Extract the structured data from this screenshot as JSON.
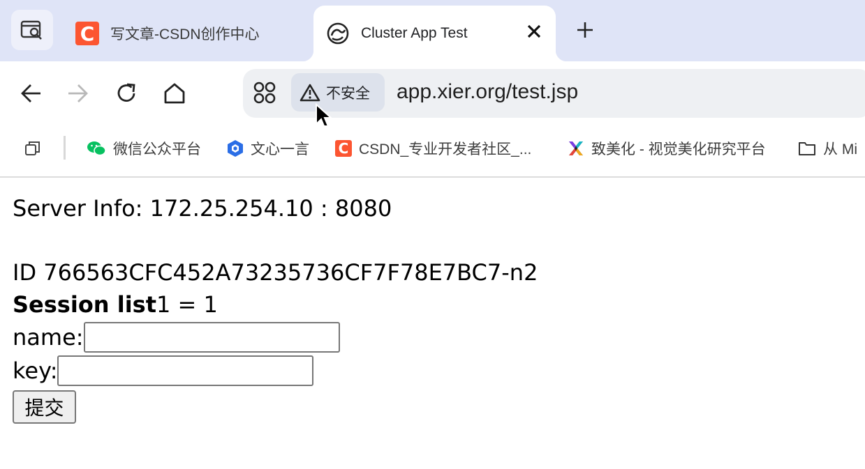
{
  "browser": {
    "tabs": [
      {
        "title": "写文章-CSDN创作中心",
        "icon": "csdn-logo-icon",
        "active": false
      },
      {
        "title": "Cluster App Test",
        "icon": "globe-swirl-icon",
        "active": true
      }
    ],
    "csdn_letter": "C",
    "address_bar": {
      "security_label": "不安全",
      "url": "app.xier.org/test.jsp"
    },
    "bookmarks": [
      {
        "label": "微信公众平台",
        "icon": "wechat-icon"
      },
      {
        "label": "文心一言",
        "icon": "wenxin-icon"
      },
      {
        "label": "CSDN_专业开发者社区_...",
        "icon": "csdn-logo-icon"
      },
      {
        "label": "致美化 - 视觉美化研究平台",
        "icon": "zhimeihua-icon"
      },
      {
        "label": "从 Mi",
        "icon": "folder-icon"
      }
    ],
    "colors": {
      "tabstrip": "#dfe4f7",
      "omnibox": "#eef0f3",
      "csdn": "#fc5531",
      "wechat": "#07c160"
    }
  },
  "page": {
    "server_info": "Server Info: 172.25.254.10 : 8080",
    "session_id": "ID 766563CFC452A73235736CF7F78E7BC7-n2",
    "session_list_label": "Session list",
    "session_list_value": "1  = 1",
    "name_label": "name:",
    "name_value": "",
    "key_label": "key:",
    "key_value": "",
    "submit_label": "提交"
  }
}
